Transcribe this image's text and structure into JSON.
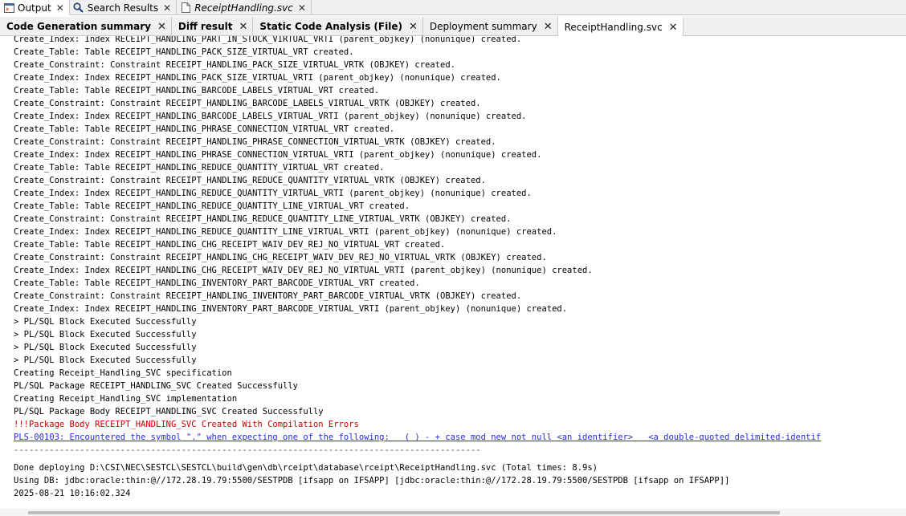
{
  "top_tabs": [
    {
      "label": "Output",
      "icon": "output-icon",
      "active": true
    },
    {
      "label": "Search Results",
      "icon": "search-icon",
      "active": false
    },
    {
      "label": "ReceiptHandling.svc",
      "icon": "file-icon",
      "active": false
    }
  ],
  "sub_tabs": [
    {
      "label": "Code Generation summary",
      "bold": true
    },
    {
      "label": "Diff result",
      "bold": true
    },
    {
      "label": "Static Code Analysis (File)",
      "bold": true
    },
    {
      "label": "Deployment summary",
      "bold": false
    },
    {
      "label": "ReceiptHandling.svc",
      "bold": false,
      "active": true
    }
  ],
  "close_glyph": "✕",
  "output_lines": [
    {
      "text": "Create_Index: Index RECEIPT_HANDLING_PART_IN_STOCK_VIRTUAL_VRTI (parent_objkey) (nonunique) created.",
      "style": "normal"
    },
    {
      "text": "Create_Table: Table RECEIPT_HANDLING_PACK_SIZE_VIRTUAL_VRT created.",
      "style": "normal"
    },
    {
      "text": "Create_Constraint: Constraint RECEIPT_HANDLING_PACK_SIZE_VIRTUAL_VRTK (OBJKEY) created.",
      "style": "normal"
    },
    {
      "text": "Create_Index: Index RECEIPT_HANDLING_PACK_SIZE_VIRTUAL_VRTI (parent_objkey) (nonunique) created.",
      "style": "normal"
    },
    {
      "text": "Create_Table: Table RECEIPT_HANDLING_BARCODE_LABELS_VIRTUAL_VRT created.",
      "style": "normal"
    },
    {
      "text": "Create_Constraint: Constraint RECEIPT_HANDLING_BARCODE_LABELS_VIRTUAL_VRTK (OBJKEY) created.",
      "style": "normal"
    },
    {
      "text": "Create_Index: Index RECEIPT_HANDLING_BARCODE_LABELS_VIRTUAL_VRTI (parent_objkey) (nonunique) created.",
      "style": "normal"
    },
    {
      "text": "Create_Table: Table RECEIPT_HANDLING_PHRASE_CONNECTION_VIRTUAL_VRT created.",
      "style": "normal"
    },
    {
      "text": "Create_Constraint: Constraint RECEIPT_HANDLING_PHRASE_CONNECTION_VIRTUAL_VRTK (OBJKEY) created.",
      "style": "normal"
    },
    {
      "text": "Create_Index: Index RECEIPT_HANDLING_PHRASE_CONNECTION_VIRTUAL_VRTI (parent_objkey) (nonunique) created.",
      "style": "normal"
    },
    {
      "text": "Create_Table: Table RECEIPT_HANDLING_REDUCE_QUANTITY_VIRTUAL_VRT created.",
      "style": "normal"
    },
    {
      "text": "Create_Constraint: Constraint RECEIPT_HANDLING_REDUCE_QUANTITY_VIRTUAL_VRTK (OBJKEY) created.",
      "style": "normal"
    },
    {
      "text": "Create_Index: Index RECEIPT_HANDLING_REDUCE_QUANTITY_VIRTUAL_VRTI (parent_objkey) (nonunique) created.",
      "style": "normal"
    },
    {
      "text": "Create_Table: Table RECEIPT_HANDLING_REDUCE_QUANTITY_LINE_VIRTUAL_VRT created.",
      "style": "normal"
    },
    {
      "text": "Create_Constraint: Constraint RECEIPT_HANDLING_REDUCE_QUANTITY_LINE_VIRTUAL_VRTK (OBJKEY) created.",
      "style": "normal"
    },
    {
      "text": "Create_Index: Index RECEIPT_HANDLING_REDUCE_QUANTITY_LINE_VIRTUAL_VRTI (parent_objkey) (nonunique) created.",
      "style": "normal"
    },
    {
      "text": "Create_Table: Table RECEIPT_HANDLING_CHG_RECEIPT_WAIV_DEV_REJ_NO_VIRTUAL_VRT created.",
      "style": "normal"
    },
    {
      "text": "Create_Constraint: Constraint RECEIPT_HANDLING_CHG_RECEIPT_WAIV_DEV_REJ_NO_VIRTUAL_VRTK (OBJKEY) created.",
      "style": "normal"
    },
    {
      "text": "Create_Index: Index RECEIPT_HANDLING_CHG_RECEIPT_WAIV_DEV_REJ_NO_VIRTUAL_VRTI (parent_objkey) (nonunique) created.",
      "style": "normal"
    },
    {
      "text": "Create_Table: Table RECEIPT_HANDLING_INVENTORY_PART_BARCODE_VIRTUAL_VRT created.",
      "style": "normal"
    },
    {
      "text": "Create_Constraint: Constraint RECEIPT_HANDLING_INVENTORY_PART_BARCODE_VIRTUAL_VRTK (OBJKEY) created.",
      "style": "normal"
    },
    {
      "text": "Create_Index: Index RECEIPT_HANDLING_INVENTORY_PART_BARCODE_VIRTUAL_VRTI (parent_objkey) (nonunique) created.",
      "style": "normal"
    },
    {
      "text": "> PL/SQL Block Executed Successfully",
      "style": "normal"
    },
    {
      "text": "> PL/SQL Block Executed Successfully",
      "style": "normal"
    },
    {
      "text": "> PL/SQL Block Executed Successfully",
      "style": "normal"
    },
    {
      "text": "> PL/SQL Block Executed Successfully",
      "style": "normal"
    },
    {
      "text": "Creating Receipt_Handling_SVC specification",
      "style": "normal"
    },
    {
      "text": "PL/SQL Package RECEIPT_HANDLING_SVC Created Successfully",
      "style": "normal"
    },
    {
      "text": "Creating Receipt_Handling_SVC implementation",
      "style": "normal"
    },
    {
      "text": "PL/SQL Package Body RECEIPT_HANDLING_SVC Created Successfully",
      "style": "normal"
    },
    {
      "text": "!!!Package Body RECEIPT_HANDLING_SVC Created With Compilation Errors",
      "style": "err"
    },
    {
      "text": "PLS-00103: Encountered the symbol \".\" when expecting one of the following:   ( ) - + case mod new not null <an identifier>   <a double-quoted delimited-identif",
      "style": "link"
    },
    {
      "text": "--------------------------------------------------------------------------------------------",
      "style": "sep"
    },
    {
      "text": "Done deploying D:\\CSI\\NEC\\SESTCL\\SESTCL\\build\\gen\\db\\rceipt\\database\\rceipt\\ReceiptHandling.svc (Total times: 8.9s)",
      "style": "normal"
    },
    {
      "text": "Using DB: jdbc:oracle:thin:@//172.28.19.79:5500/SESTPDB [ifsapp on IFSAPP] [jdbc:oracle:thin:@//172.28.19.79:5500/SESTPDB [ifsapp on IFSAPP]]",
      "style": "normal"
    },
    {
      "text": "2025-08-21 10:16:02.324",
      "style": "normal"
    }
  ]
}
